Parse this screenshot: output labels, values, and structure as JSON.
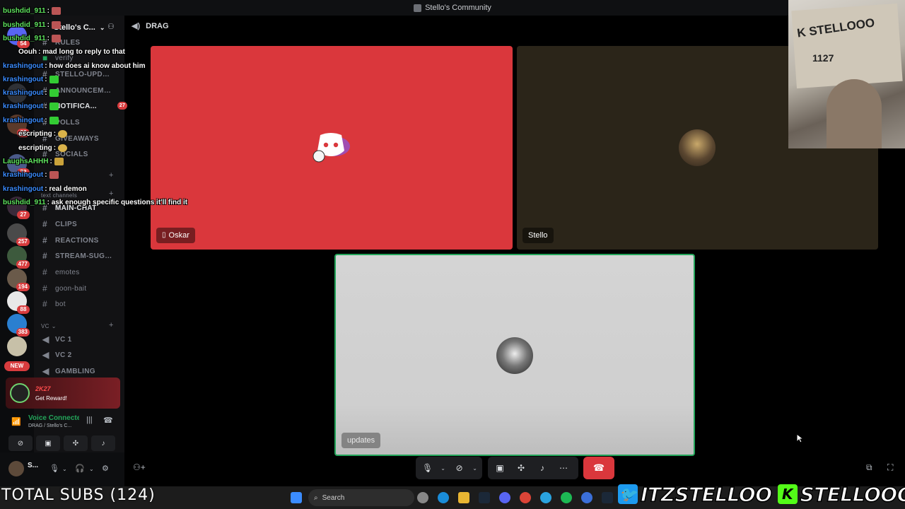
{
  "window": {
    "title": "Stello's Community"
  },
  "server": {
    "name": "Stello's C..."
  },
  "channels": [
    {
      "label": "verify",
      "type": "text",
      "top": 0
    },
    {
      "label": "RULES",
      "type": "text"
    },
    {
      "label": "STELLO-UPDA...",
      "type": "text"
    },
    {
      "label": "ANNOUNCEME...",
      "type": "text"
    },
    {
      "label": "NOTIFICA...",
      "type": "text",
      "badge": "27"
    },
    {
      "label": "POLLS",
      "type": "text"
    },
    {
      "label": "GIVEAWAYS",
      "type": "text"
    },
    {
      "label": "SOCIALS",
      "type": "text"
    },
    {
      "label": "text channels",
      "type": "category"
    },
    {
      "label": "MAIN-CHAT",
      "type": "text"
    },
    {
      "label": "CLIPS",
      "type": "text"
    },
    {
      "label": "REACTIONS",
      "type": "text"
    },
    {
      "label": "STREAM-SUGG...",
      "type": "text"
    },
    {
      "label": "emotes",
      "type": "text"
    },
    {
      "label": "goon-bait",
      "type": "text"
    },
    {
      "label": "bot",
      "type": "text"
    },
    {
      "label": "VC",
      "type": "category"
    },
    {
      "label": "VC 1",
      "type": "voice"
    },
    {
      "label": "VC 2",
      "type": "voice"
    },
    {
      "label": "GAMBLING",
      "type": "voice"
    }
  ],
  "rail_badges": [
    "54",
    "22",
    "72",
    "27",
    "257",
    "477",
    "194",
    "88",
    "383"
  ],
  "rail_new": "NEW",
  "reward": {
    "label": "Get Reward!",
    "brand": "2K27"
  },
  "voice": {
    "status": "Voice Connected",
    "location": "DRAG / Stello's C..."
  },
  "user": {
    "name": "S..."
  },
  "call": {
    "channel": "DRAG",
    "tiles": [
      {
        "name": "Oskar",
        "color": "#da373c"
      },
      {
        "name": "Stello",
        "color": "#2b2519"
      },
      {
        "name": "updates",
        "color": "#d4d4d4"
      }
    ]
  },
  "chat": [
    {
      "user": "bushdid_911",
      "msg": "",
      "color": "#5fe35f"
    },
    {
      "user": "bushdid_911",
      "msg": "",
      "color": "#5fe35f"
    },
    {
      "user": "bushdid_911",
      "msg": "",
      "color": "#5fe35f"
    },
    {
      "user": "Oouh",
      "msg": "mad long to reply to that",
      "color": "#ffffff"
    },
    {
      "user": "krashingout",
      "msg": "how does ai know about him",
      "color": "#3b8cff"
    },
    {
      "user": "krashingout",
      "msg": "",
      "color": "#3b8cff"
    },
    {
      "user": "krashingout",
      "msg": "",
      "color": "#3b8cff"
    },
    {
      "user": "krashingout",
      "msg": "",
      "color": "#3b8cff"
    },
    {
      "user": "krashingout",
      "msg": "",
      "color": "#3b8cff"
    },
    {
      "user": "escripting",
      "msg": "",
      "color": "#ffffff"
    },
    {
      "user": "escripting",
      "msg": "",
      "color": "#ffffff"
    },
    {
      "user": "LaughsAHHH",
      "msg": "",
      "color": "#5fe35f"
    },
    {
      "user": "krashingout",
      "msg": "",
      "color": "#3b8cff"
    },
    {
      "user": "krashingout",
      "msg": "real demon",
      "color": "#3b8cff"
    },
    {
      "user": "bushdid_911",
      "msg": "ask enough specific questions it'll find it",
      "color": "#5fe35f"
    }
  ],
  "taskbar": {
    "search": "Search"
  },
  "overlay": {
    "subs": "TOTAL SUBS (124)",
    "twitter": "ITZSTELLOO",
    "kick": "STELLOOO",
    "kick_letter": "K"
  },
  "webcam": {
    "box_text": "STELLOOO",
    "box_num": "1127",
    "box_k": "K"
  },
  "colors": {
    "accent_red": "#da373c",
    "online_green": "#23a55a",
    "sidebar_bg": "#121214"
  }
}
